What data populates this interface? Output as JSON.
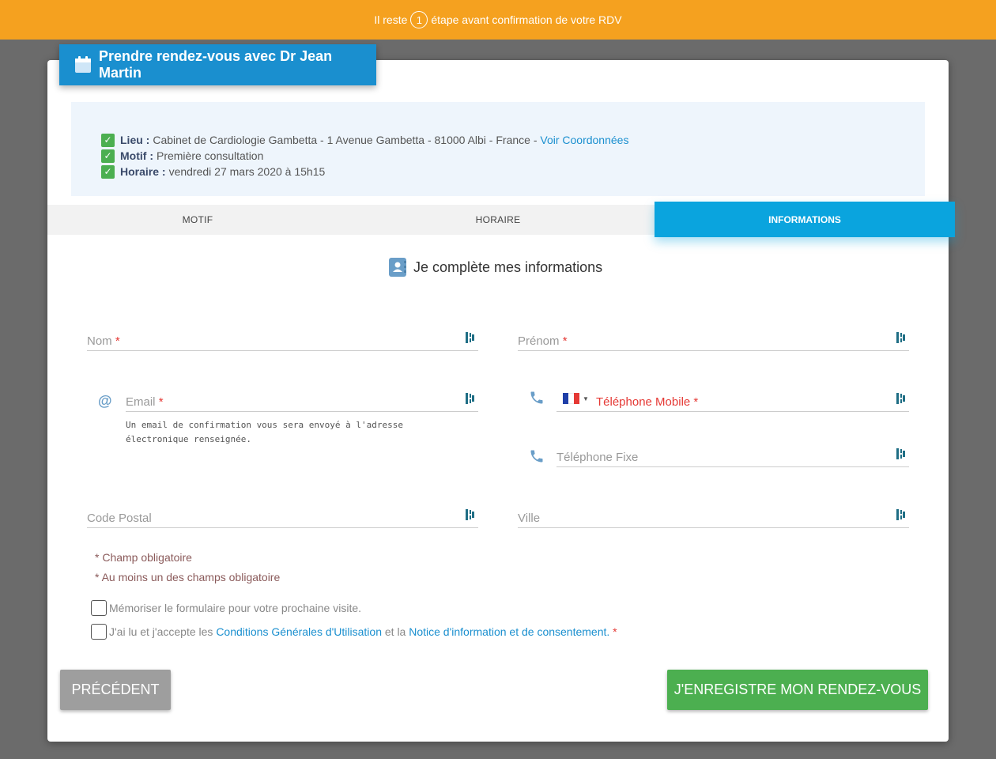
{
  "top_bar": {
    "prefix": "Il reste",
    "step": "1",
    "suffix": "étape avant confirmation de votre RDV"
  },
  "title": "Prendre rendez-vous avec Dr Jean Martin",
  "summary": {
    "lieu_label": "Lieu :",
    "lieu_value": "Cabinet de Cardiologie Gambetta - 1 Avenue Gambetta - 81000 Albi - France -",
    "lieu_link": "Voir Coordonnées",
    "motif_label": "Motif :",
    "motif_value": "Première consultation",
    "horaire_label": "Horaire :",
    "horaire_value": "vendredi 27 mars 2020 à 15h15"
  },
  "tabs": {
    "motif": "MOTIF",
    "horaire": "HORAIRE",
    "informations": "INFORMATIONS"
  },
  "section_title": "Je complète mes informations",
  "fields": {
    "nom": "Nom",
    "prenom": "Prénom",
    "email": "Email",
    "email_hint": "Un email de confirmation vous sera envoyé à l'adresse électronique renseignée.",
    "tel_mobile": "Téléphone Mobile",
    "tel_fixe": "Téléphone Fixe",
    "code_postal": "Code Postal",
    "ville": "Ville",
    "required_mark": "*"
  },
  "notes": {
    "required": "* Champ obligatoire",
    "one_required": "* Au moins un des champs obligatoire"
  },
  "checkboxes": {
    "remember": "Mémoriser le formulaire pour votre prochaine visite.",
    "accept_prefix": "J'ai lu et j'accepte les",
    "accept_link1": "Conditions Générales d'Utilisation",
    "accept_mid": "et la",
    "accept_link2": "Notice d'information et de consentement.",
    "accept_req": "*"
  },
  "buttons": {
    "previous": "PRÉCÉDENT",
    "save": "J'ENREGISTRE MON RENDEZ-VOUS"
  },
  "colors": {
    "top_bar": "#f5a11f",
    "primary": "#1a8fcf",
    "tab_active": "#0aa4de",
    "success": "#4caf50",
    "required": "#e53935"
  },
  "icons": [
    "calendar-icon",
    "check-icon",
    "contact-card-icon",
    "barcode-icon",
    "at-icon",
    "phone-icon",
    "france-flag-icon"
  ]
}
